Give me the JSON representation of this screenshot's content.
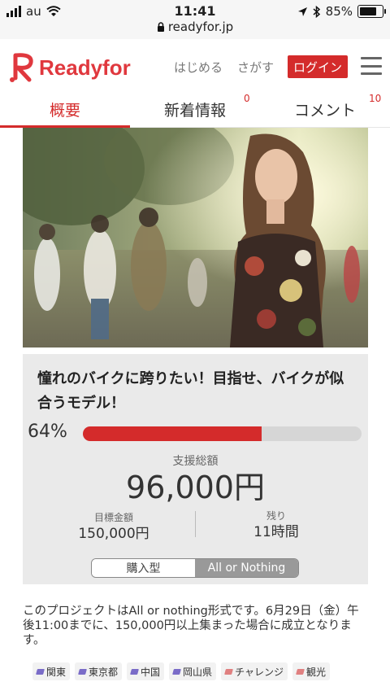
{
  "status_bar": {
    "carrier": "au",
    "time": "11:41",
    "url": "readyfor.jp",
    "battery": "85%",
    "battery_level": 0.85
  },
  "header": {
    "logo_text": "Readyfor",
    "nav": {
      "start": "はじめる",
      "search": "さがす"
    },
    "login_label": "ログイン",
    "brand_color": "#d42b2b"
  },
  "tabs": [
    {
      "label": "概要",
      "count": ""
    },
    {
      "label": "新着情報",
      "count": "0"
    },
    {
      "label": "コメント",
      "count": "10"
    }
  ],
  "project": {
    "title": "憧れのバイクに跨りたい！目指せ、バイクが似合うモデル！",
    "progress_percent": 64,
    "progress_label": "64%",
    "support_label": "支援総額",
    "support_amount": "96,000円",
    "goal_label": "目標金額",
    "goal_amount": "150,000円",
    "remaining_label": "残り",
    "remaining_value": "11時間",
    "type_options": [
      "購入型",
      "All or Nothing"
    ],
    "type_selected": "All or Nothing",
    "description": "このプロジェクトはAll or nothing形式です。6月29日（金）午後11:00までに、150,000円以上集まった場合に成立となります。"
  },
  "tags": [
    {
      "label": "関東",
      "color": "#7a6cc8"
    },
    {
      "label": "東京都",
      "color": "#7a6cc8"
    },
    {
      "label": "中国",
      "color": "#7a6cc8"
    },
    {
      "label": "岡山県",
      "color": "#7a6cc8"
    },
    {
      "label": "チャレンジ",
      "color": "#e08080"
    },
    {
      "label": "観光",
      "color": "#e08080"
    }
  ]
}
